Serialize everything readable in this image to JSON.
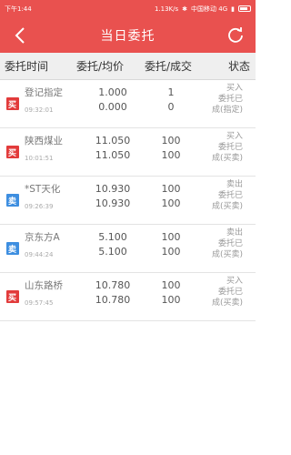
{
  "statusbar": {
    "left": "下午1:44",
    "speed": "1.13K/s",
    "carrier": "中国移动 4G"
  },
  "title": "当日委托",
  "header": {
    "col1": "委托时间",
    "col2": "委托/均价",
    "col3": "委托/成交",
    "col4": "状态"
  },
  "colors": {
    "brand_red": "#e9514f",
    "buy_red": "#e23b3b",
    "sell_blue": "#3d8ee0"
  },
  "rows": [
    {
      "badge": "买",
      "type": "buy",
      "name": "登记指定",
      "time": "09:32:01",
      "price1": "1.000",
      "price2": "0.000",
      "qty1": "1",
      "qty2": "0",
      "status1": "买入",
      "status2": "委托已",
      "status3": "成(指定)"
    },
    {
      "badge": "买",
      "type": "buy",
      "name": "陕西煤业",
      "time": "10:01:51",
      "price1": "11.050",
      "price2": "11.050",
      "qty1": "100",
      "qty2": "100",
      "status1": "买入",
      "status2": "委托已",
      "status3": "成(买卖)"
    },
    {
      "badge": "卖",
      "type": "sell",
      "name": "*ST天化",
      "time": "09:26:39",
      "price1": "10.930",
      "price2": "10.930",
      "qty1": "100",
      "qty2": "100",
      "status1": "卖出",
      "status2": "委托已",
      "status3": "成(买卖)"
    },
    {
      "badge": "卖",
      "type": "sell",
      "name": "京东方A",
      "time": "09:44:24",
      "price1": "5.100",
      "price2": "5.100",
      "qty1": "100",
      "qty2": "100",
      "status1": "卖出",
      "status2": "委托已",
      "status3": "成(买卖)"
    },
    {
      "badge": "买",
      "type": "buy",
      "name": "山东路桥",
      "time": "09:57:45",
      "price1": "10.780",
      "price2": "10.780",
      "qty1": "100",
      "qty2": "100",
      "status1": "买入",
      "status2": "委托已",
      "status3": "成(买卖)"
    }
  ]
}
